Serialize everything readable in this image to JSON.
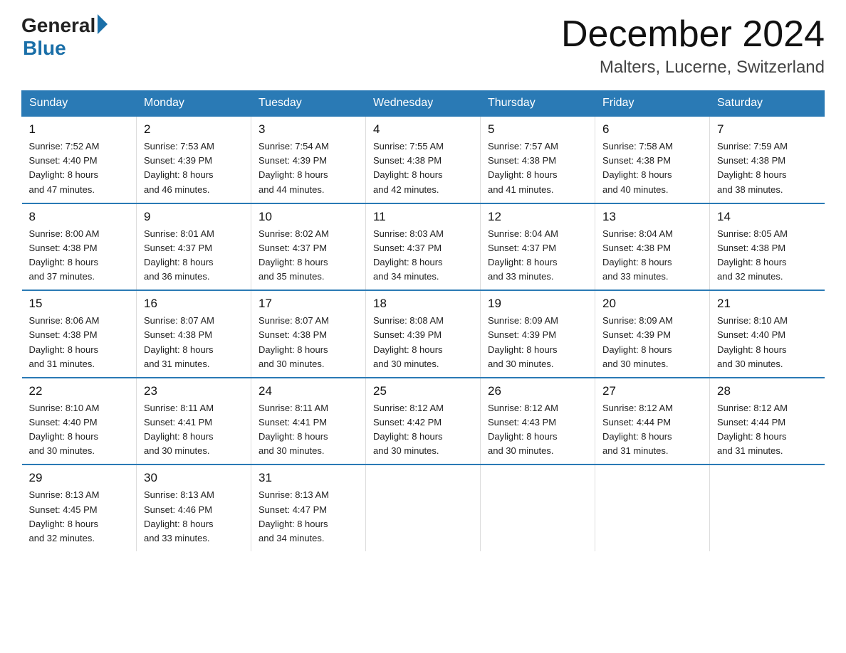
{
  "header": {
    "logo_general": "General",
    "logo_blue": "Blue",
    "month_title": "December 2024",
    "location": "Malters, Lucerne, Switzerland"
  },
  "columns": [
    "Sunday",
    "Monday",
    "Tuesday",
    "Wednesday",
    "Thursday",
    "Friday",
    "Saturday"
  ],
  "weeks": [
    [
      {
        "day": "1",
        "sunrise": "7:52 AM",
        "sunset": "4:40 PM",
        "daylight": "8 hours and 47 minutes."
      },
      {
        "day": "2",
        "sunrise": "7:53 AM",
        "sunset": "4:39 PM",
        "daylight": "8 hours and 46 minutes."
      },
      {
        "day": "3",
        "sunrise": "7:54 AM",
        "sunset": "4:39 PM",
        "daylight": "8 hours and 44 minutes."
      },
      {
        "day": "4",
        "sunrise": "7:55 AM",
        "sunset": "4:38 PM",
        "daylight": "8 hours and 42 minutes."
      },
      {
        "day": "5",
        "sunrise": "7:57 AM",
        "sunset": "4:38 PM",
        "daylight": "8 hours and 41 minutes."
      },
      {
        "day": "6",
        "sunrise": "7:58 AM",
        "sunset": "4:38 PM",
        "daylight": "8 hours and 40 minutes."
      },
      {
        "day": "7",
        "sunrise": "7:59 AM",
        "sunset": "4:38 PM",
        "daylight": "8 hours and 38 minutes."
      }
    ],
    [
      {
        "day": "8",
        "sunrise": "8:00 AM",
        "sunset": "4:38 PM",
        "daylight": "8 hours and 37 minutes."
      },
      {
        "day": "9",
        "sunrise": "8:01 AM",
        "sunset": "4:37 PM",
        "daylight": "8 hours and 36 minutes."
      },
      {
        "day": "10",
        "sunrise": "8:02 AM",
        "sunset": "4:37 PM",
        "daylight": "8 hours and 35 minutes."
      },
      {
        "day": "11",
        "sunrise": "8:03 AM",
        "sunset": "4:37 PM",
        "daylight": "8 hours and 34 minutes."
      },
      {
        "day": "12",
        "sunrise": "8:04 AM",
        "sunset": "4:37 PM",
        "daylight": "8 hours and 33 minutes."
      },
      {
        "day": "13",
        "sunrise": "8:04 AM",
        "sunset": "4:38 PM",
        "daylight": "8 hours and 33 minutes."
      },
      {
        "day": "14",
        "sunrise": "8:05 AM",
        "sunset": "4:38 PM",
        "daylight": "8 hours and 32 minutes."
      }
    ],
    [
      {
        "day": "15",
        "sunrise": "8:06 AM",
        "sunset": "4:38 PM",
        "daylight": "8 hours and 31 minutes."
      },
      {
        "day": "16",
        "sunrise": "8:07 AM",
        "sunset": "4:38 PM",
        "daylight": "8 hours and 31 minutes."
      },
      {
        "day": "17",
        "sunrise": "8:07 AM",
        "sunset": "4:38 PM",
        "daylight": "8 hours and 30 minutes."
      },
      {
        "day": "18",
        "sunrise": "8:08 AM",
        "sunset": "4:39 PM",
        "daylight": "8 hours and 30 minutes."
      },
      {
        "day": "19",
        "sunrise": "8:09 AM",
        "sunset": "4:39 PM",
        "daylight": "8 hours and 30 minutes."
      },
      {
        "day": "20",
        "sunrise": "8:09 AM",
        "sunset": "4:39 PM",
        "daylight": "8 hours and 30 minutes."
      },
      {
        "day": "21",
        "sunrise": "8:10 AM",
        "sunset": "4:40 PM",
        "daylight": "8 hours and 30 minutes."
      }
    ],
    [
      {
        "day": "22",
        "sunrise": "8:10 AM",
        "sunset": "4:40 PM",
        "daylight": "8 hours and 30 minutes."
      },
      {
        "day": "23",
        "sunrise": "8:11 AM",
        "sunset": "4:41 PM",
        "daylight": "8 hours and 30 minutes."
      },
      {
        "day": "24",
        "sunrise": "8:11 AM",
        "sunset": "4:41 PM",
        "daylight": "8 hours and 30 minutes."
      },
      {
        "day": "25",
        "sunrise": "8:12 AM",
        "sunset": "4:42 PM",
        "daylight": "8 hours and 30 minutes."
      },
      {
        "day": "26",
        "sunrise": "8:12 AM",
        "sunset": "4:43 PM",
        "daylight": "8 hours and 30 minutes."
      },
      {
        "day": "27",
        "sunrise": "8:12 AM",
        "sunset": "4:44 PM",
        "daylight": "8 hours and 31 minutes."
      },
      {
        "day": "28",
        "sunrise": "8:12 AM",
        "sunset": "4:44 PM",
        "daylight": "8 hours and 31 minutes."
      }
    ],
    [
      {
        "day": "29",
        "sunrise": "8:13 AM",
        "sunset": "4:45 PM",
        "daylight": "8 hours and 32 minutes."
      },
      {
        "day": "30",
        "sunrise": "8:13 AM",
        "sunset": "4:46 PM",
        "daylight": "8 hours and 33 minutes."
      },
      {
        "day": "31",
        "sunrise": "8:13 AM",
        "sunset": "4:47 PM",
        "daylight": "8 hours and 34 minutes."
      },
      null,
      null,
      null,
      null
    ]
  ],
  "labels": {
    "sunrise": "Sunrise:",
    "sunset": "Sunset:",
    "daylight": "Daylight:"
  }
}
